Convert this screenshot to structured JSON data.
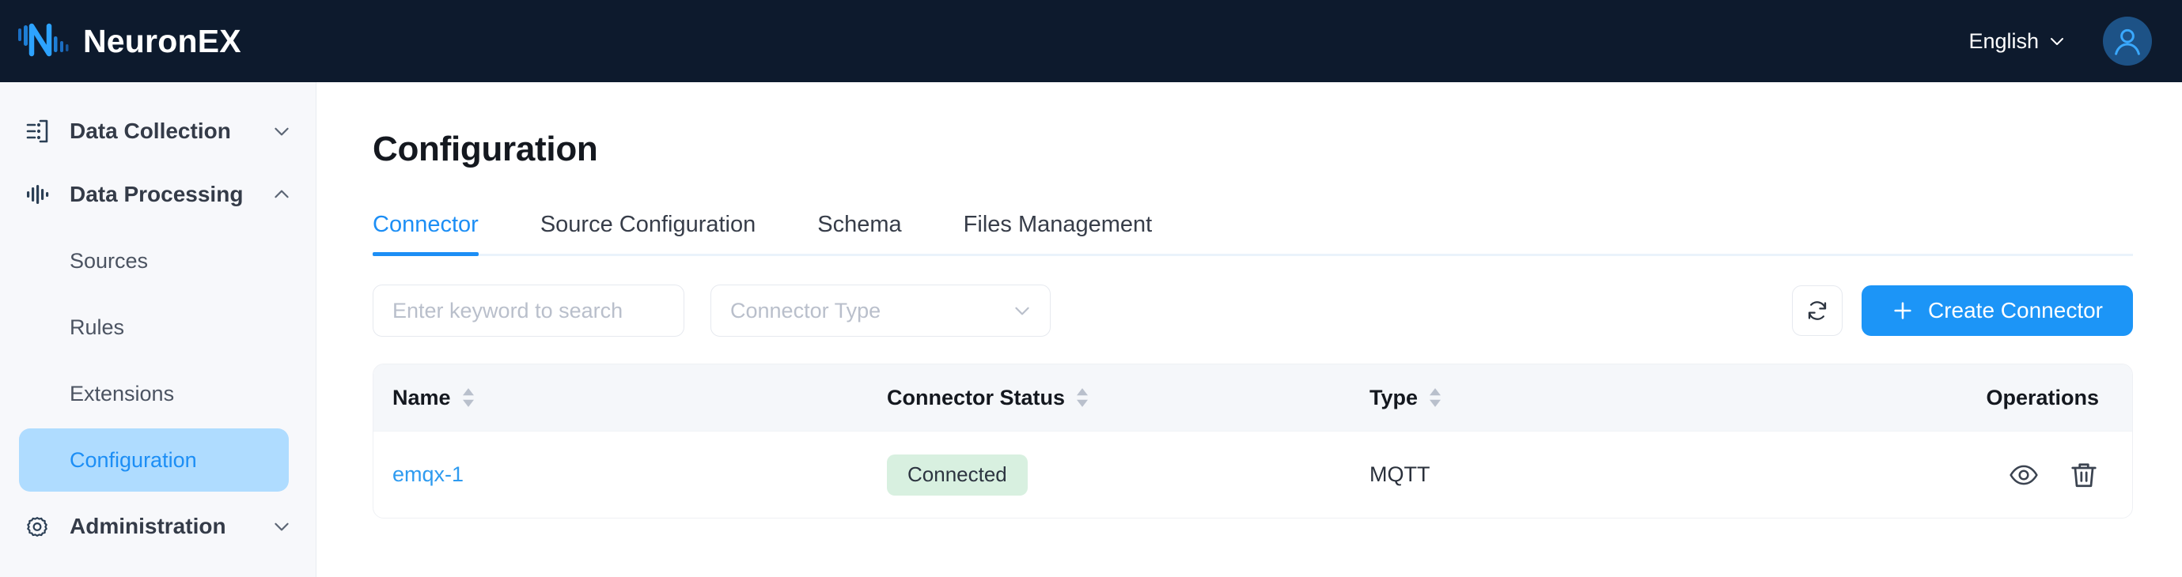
{
  "header": {
    "brand_name": "NeuronEX",
    "logo_icon": "neuronex-logo-icon",
    "language_label": "English",
    "language_chevron_icon": "chevron-down-icon",
    "avatar_icon": "user-avatar-icon",
    "background_color": "#0d1a2d"
  },
  "sidebar": {
    "background_color": "#f7f8fb",
    "active_item_bg": "#afdcff",
    "active_item_color": "#1c8ef5",
    "items": [
      {
        "label": "Data Collection",
        "icon": "data-collection-icon",
        "chevron": "chevron-down-icon",
        "type": "group",
        "expanded": false
      },
      {
        "label": "Data Processing",
        "icon": "data-processing-icon",
        "chevron": "chevron-up-icon",
        "type": "group",
        "expanded": true
      },
      {
        "label": "Sources",
        "type": "child",
        "active": false
      },
      {
        "label": "Rules",
        "type": "child",
        "active": false
      },
      {
        "label": "Extensions",
        "type": "child",
        "active": false
      },
      {
        "label": "Configuration",
        "type": "child",
        "active": true
      },
      {
        "label": "Administration",
        "icon": "gear-icon",
        "chevron": "chevron-down-icon",
        "type": "group",
        "expanded": false
      }
    ]
  },
  "main": {
    "page_title": "Configuration",
    "tabs": [
      {
        "label": "Connector",
        "active": true
      },
      {
        "label": "Source Configuration",
        "active": false
      },
      {
        "label": "Schema",
        "active": false
      },
      {
        "label": "Files Management",
        "active": false
      }
    ],
    "toolbar": {
      "search_placeholder": "Enter keyword to search",
      "search_value": "",
      "connector_type_placeholder": "Connector Type",
      "connector_type_value": "",
      "connector_type_chevron_icon": "chevron-down-icon",
      "refresh_icon": "refresh-icon",
      "create_button_label": "Create Connector",
      "create_button_icon": "plus-icon",
      "create_button_color": "#1c95f7"
    },
    "table": {
      "columns": [
        {
          "label": "Name",
          "sortable": true,
          "sort_icon": "sort-arrows-icon"
        },
        {
          "label": "Connector Status",
          "sortable": true,
          "sort_icon": "sort-arrows-icon"
        },
        {
          "label": "Type",
          "sortable": true,
          "sort_icon": "sort-arrows-icon"
        },
        {
          "label": "Operations",
          "sortable": false
        }
      ],
      "rows": [
        {
          "name": "emqx-1",
          "status": "Connected",
          "status_bg": "#d8f0e0",
          "type": "MQTT",
          "operations": [
            {
              "icon": "eye-icon",
              "name": "view-connector-button"
            },
            {
              "icon": "trash-icon",
              "name": "delete-connector-button"
            }
          ]
        }
      ]
    }
  }
}
